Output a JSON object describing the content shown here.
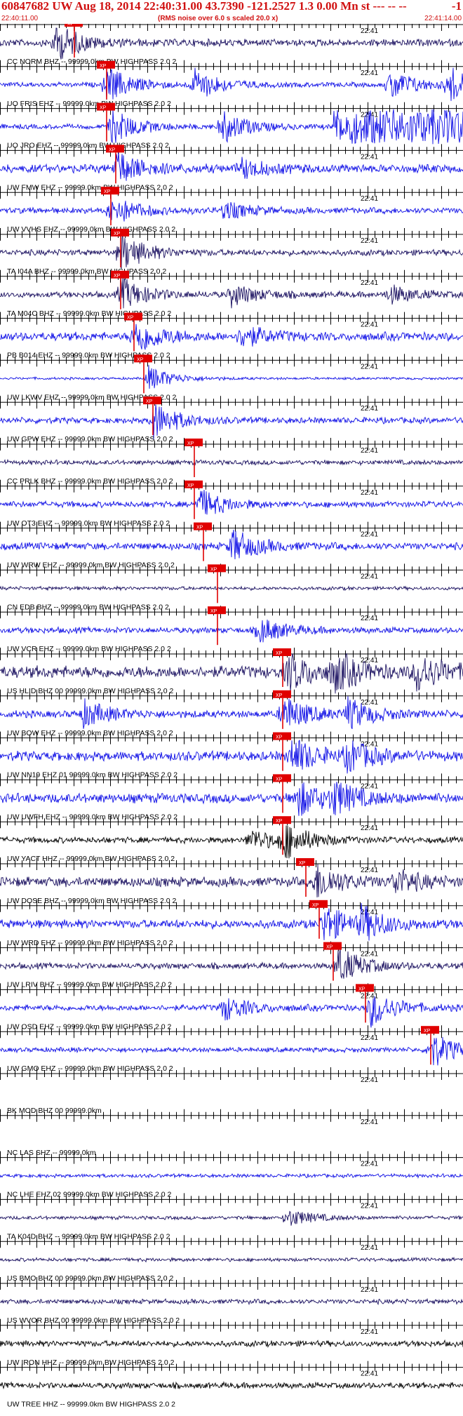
{
  "header": {
    "title": "60847682 UW Aug 18, 2014 22:40:31.00   43.7390 -121.2527  1.3 0.00 Mn st --- -- --",
    "title_tail": "-1",
    "time_start": "22:40:11.00",
    "rms_note": "(RMS noise over 6.0 s scaled 20.0 x)",
    "time_end": "22:41:14.00"
  },
  "colors": {
    "blue": "#1010e6",
    "navy": "#1a1060",
    "black": "#000000",
    "pick": "#e00000"
  },
  "mid_time_label": "22:41",
  "pick_label": "XP",
  "channels": [
    {
      "label": "CC NORM BHZ -- 99999.0km BW  HIGHPASS  2.0  2",
      "color": "navy",
      "amp": 6,
      "bursts": [
        [
          0.12,
          1.0
        ]
      ],
      "pick": 0.16
    },
    {
      "label": "UO FRIS EHZ -- 99999.0km BW  HIGHPASS  2.0  2",
      "color": "blue",
      "amp": 4,
      "bursts": [
        [
          0.23,
          1.0
        ],
        [
          0.42,
          0.9
        ],
        [
          0.84,
          0.9
        ],
        [
          0.97,
          1.0
        ]
      ],
      "clipped": true,
      "pick": 0.23
    },
    {
      "label": "UO JRO EHZ -- 99999.0km BW  HIGHPASS  2.0  2",
      "color": "blue",
      "amp": 4,
      "bursts": [
        [
          0.24,
          1.0
        ],
        [
          0.48,
          0.9
        ]
      ],
      "clipped": true,
      "block": [
        0.72,
        1.0
      ],
      "pick": 0.23
    },
    {
      "label": "UW FMW EHZ -- 99999.0km BW  HIGHPASS  2.0  2",
      "color": "blue",
      "amp": 7,
      "bursts": [
        [
          0.25,
          0.9
        ],
        [
          0.52,
          0.5
        ]
      ],
      "pick": 0.25
    },
    {
      "label": "UW VVHS EHZ -- 99999.0km BW  HIGHPASS  2.0  2",
      "color": "blue",
      "amp": 5,
      "bursts": [
        [
          0.24,
          0.8
        ],
        [
          0.48,
          0.5
        ]
      ],
      "pick": 0.24
    },
    {
      "label": "TA I04A BHZ -- 99999.0km BW  HIGHPASS  2.0  2",
      "color": "navy",
      "amp": 5,
      "bursts": [
        [
          0.26,
          1.0
        ]
      ],
      "pick": 0.26
    },
    {
      "label": "TA M04C BHZ -- 99999.0km BW  HIGHPASS  2.0  2",
      "color": "navy",
      "amp": 5,
      "bursts": [
        [
          0.26,
          0.9
        ],
        [
          0.5,
          0.6
        ],
        [
          0.84,
          0.5
        ]
      ],
      "pick": 0.26
    },
    {
      "label": "PB B014 EHZ -- 99999.0km BW  HIGHPASS  2.0  2",
      "color": "blue",
      "amp": 7,
      "bursts": [
        [
          0.29,
          1.0
        ],
        [
          0.52,
          0.6
        ]
      ],
      "pick": 0.29
    },
    {
      "label": "UW LKWV EHZ -- 99999.0km BW  HIGHPASS  2.0  2",
      "color": "blue",
      "amp": 2,
      "bursts": [
        [
          0.32,
          0.7
        ]
      ],
      "pick": 0.31
    },
    {
      "label": "UW GPW EHZ -- 99999.0km BW  HIGHPASS  2.0  2",
      "color": "blue",
      "amp": 5,
      "bursts": [
        [
          0.33,
          1.0
        ]
      ],
      "pick": 0.33
    },
    {
      "label": "CC PRLK BHZ -- 99999.0km BW  HIGHPASS  2.0  2",
      "color": "navy",
      "amp": 4,
      "bursts": [],
      "pick": 0.42
    },
    {
      "label": "UW OT3 EHZ -- 99999.0km BW  HIGHPASS  2.0  2",
      "color": "blue",
      "amp": 5,
      "bursts": [
        [
          0.43,
          0.8
        ]
      ],
      "pick": 0.42
    },
    {
      "label": "UW WRW EHZ -- 99999.0km BW  HIGHPASS  2.0  2",
      "color": "blue",
      "amp": 6,
      "bursts": [
        [
          0.5,
          0.9
        ]
      ],
      "pick": 0.44
    },
    {
      "label": "CN EDB BHZ -- 99999.0km BW  HIGHPASS  2.0  2",
      "color": "navy",
      "amp": 3,
      "bursts": [],
      "pick": 0.47
    },
    {
      "label": "UW VCR EHZ -- 99999.0km BW  HIGHPASS  2.0  2",
      "color": "blue",
      "amp": 5,
      "bursts": [
        [
          0.56,
          0.7
        ]
      ],
      "pick": 0.47
    },
    {
      "label": "US HLID BHZ 00 99999.0km BW  HIGHPASS  2.0  2",
      "color": "navy",
      "amp": 10,
      "bursts": [
        [
          0.62,
          1.0
        ],
        [
          0.72,
          1.0
        ],
        [
          0.9,
          1.0
        ]
      ],
      "pick": 0.61
    },
    {
      "label": "UW BOW EHZ -- 99999.0km BW  HIGHPASS  2.0  2",
      "color": "blue",
      "amp": 6,
      "bursts": [
        [
          0.18,
          0.7
        ],
        [
          0.61,
          1.0
        ],
        [
          0.75,
          0.8
        ]
      ],
      "pick": 0.61
    },
    {
      "label": "UW NN19 EHZ 01 99999.0km BW  HIGHPASS  2.0  2",
      "color": "blue",
      "amp": 8,
      "bursts": [
        [
          0.63,
          1.0
        ],
        [
          0.75,
          0.8
        ]
      ],
      "pick": 0.61
    },
    {
      "label": "UW UWFH EHZ -- 99999.0km BW  HIGHPASS  2.0  2",
      "color": "blue",
      "amp": 8,
      "bursts": [
        [
          0.64,
          1.0
        ],
        [
          0.72,
          0.8
        ]
      ],
      "pick": 0.61
    },
    {
      "label": "UW YACT HHZ -- 99999.0km BW  HIGHPASS  2.0  2",
      "color": "black",
      "amp": 5,
      "bursts": [
        [
          0.54,
          0.6
        ],
        [
          0.61,
          1.0
        ]
      ],
      "pick": 0.61
    },
    {
      "label": "UW DOSE BHZ -- 99999.0km BW  HIGHPASS  2.0  2",
      "color": "navy",
      "amp": 8,
      "bursts": [
        [
          0.68,
          1.0
        ],
        [
          0.85,
          0.7
        ]
      ],
      "pick": 0.66
    },
    {
      "label": "UW WRD EHZ -- 99999.0km BW  HIGHPASS  2.0  2",
      "color": "blue",
      "amp": 7,
      "bursts": [
        [
          0.7,
          1.0
        ],
        [
          0.78,
          0.8
        ]
      ],
      "pick": 0.69
    },
    {
      "label": "UW LRIV BHZ -- 99999.0km BW  HIGHPASS  2.0  2",
      "color": "navy",
      "amp": 5,
      "bursts": [
        [
          0.73,
          1.0
        ]
      ],
      "pick": 0.72
    },
    {
      "label": "UW OSD EHZ -- 99999.0km BW  HIGHPASS  2.0  2",
      "color": "blue",
      "amp": 5,
      "bursts": [
        [
          0.48,
          0.7
        ],
        [
          0.8,
          1.0
        ]
      ],
      "pick": 0.79
    },
    {
      "label": "UW GMO EHZ -- 99999.0km BW  HIGHPASS  2.0  2",
      "color": "blue",
      "amp": 4,
      "bursts": [
        [
          0.93,
          1.0
        ]
      ],
      "pick": 0.93
    },
    {
      "label": "BK MOD BHZ 00 99999.0km",
      "color": "blue",
      "amp": 0,
      "bursts": [],
      "flat": true
    },
    {
      "label": "NC LAS SHZ -- 99999.0km",
      "color": "blue",
      "amp": 0,
      "bursts": [],
      "flat": true
    },
    {
      "label": "NC LHE EHZ 02 99999.0km BW  HIGHPASS  2.0  2",
      "color": "blue",
      "amp": 3,
      "bursts": []
    },
    {
      "label": "TA K04D BHZ -- 99999.0km BW  HIGHPASS  2.0  2",
      "color": "navy",
      "amp": 3,
      "bursts": [
        [
          0.62,
          0.5
        ]
      ]
    },
    {
      "label": "US BMO BHZ 00 99999.0km BW  HIGHPASS  2.0  2",
      "color": "navy",
      "amp": 3,
      "bursts": []
    },
    {
      "label": "US WVOR BHZ 00 99999.0km BW  HIGHPASS  2.0  2",
      "color": "navy",
      "amp": 4,
      "bursts": []
    },
    {
      "label": "UW IRON HHZ -- 99999.0km BW  HIGHPASS  2.0  2",
      "color": "black",
      "amp": 5,
      "bursts": []
    },
    {
      "label": "UW TREE HHZ -- 99999.0km BW  HIGHPASS  2.0  2",
      "color": "black",
      "amp": 5,
      "bursts": []
    }
  ]
}
